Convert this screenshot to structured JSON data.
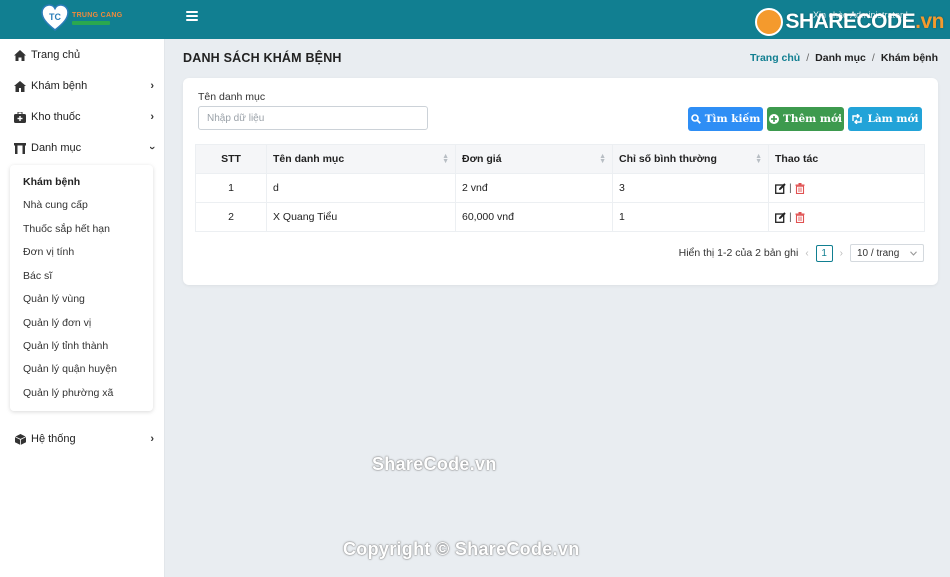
{
  "header": {
    "logo_text": "TRUNG CANG",
    "greeting": "Xin chào Administrator !",
    "watermark_logo": "SHARECODE",
    "watermark_logo_suffix": ".vn",
    "brand_color": "#117f91"
  },
  "sidebar": {
    "items": [
      {
        "label": "Trang chủ",
        "icon": "home-icon"
      },
      {
        "label": "Khám bệnh",
        "icon": "house-icon"
      },
      {
        "label": "Kho thuốc",
        "icon": "medkit-icon"
      },
      {
        "label": "Danh mục",
        "icon": "columns-icon"
      },
      {
        "label": "Hệ thống",
        "icon": "cube-icon"
      }
    ],
    "submenu": [
      "Khám bệnh",
      "Nhà cung cấp",
      "Thuốc sắp hết hạn",
      "Đơn vị tính",
      "Bác sĩ",
      "Quản lý vùng",
      "Quản lý đơn vị",
      "Quản lý tỉnh thành",
      "Quản lý quận huyện",
      "Quản lý phường xã"
    ]
  },
  "page": {
    "title": "DANH SÁCH KHÁM BỆNH",
    "breadcrumb": [
      "Trang chủ",
      "Danh mục",
      "Khám bệnh"
    ]
  },
  "filter": {
    "label": "Tên danh mục",
    "placeholder": "Nhập dữ liệu"
  },
  "buttons": {
    "search": "Tìm kiếm",
    "add": "Thêm mới",
    "reset": "Làm mới"
  },
  "table": {
    "columns": [
      "STT",
      "Tên danh mục",
      "Đơn giá",
      "Chỉ số bình thường",
      "Thao tác"
    ],
    "rows": [
      [
        "1",
        "d",
        "2 vnđ",
        "3"
      ],
      [
        "2",
        "X Quang Tiểu",
        "60,000 vnđ",
        "1"
      ]
    ]
  },
  "pagination": {
    "summary": "Hiển thị 1-2 của 2 bản ghi",
    "current_page": "1",
    "page_size": "10 / trang"
  },
  "watermarks": [
    "ShareCode.vn",
    "Copyright © ShareCode.vn"
  ]
}
